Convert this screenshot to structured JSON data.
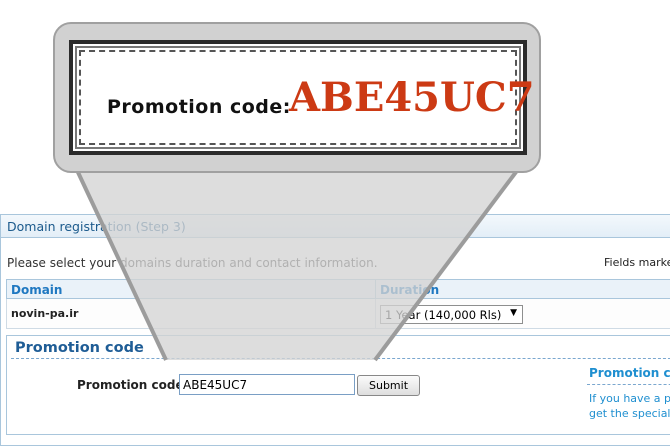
{
  "panel": {
    "title": "Domain registration (Step 3)",
    "instructions": "Please select your domains duration and contact information.",
    "fields_note": "Fields marked"
  },
  "table": {
    "headers": [
      "Domain",
      "Duration"
    ],
    "rows": [
      {
        "domain": "novin-pa.ir",
        "duration": "1 Year (140,000 Rls)"
      }
    ]
  },
  "promo": {
    "heading": "Promotion code",
    "label": "Promotion code",
    "value": "ABE45UC7",
    "submit_label": "Submit",
    "side_title": "Promotion co",
    "side_text_1": "If you have a pro",
    "side_text_2": "get the special pr"
  },
  "zoom": {
    "label": "Promotion code:",
    "code": "ABE45UC7"
  },
  "colors": {
    "accent_blue": "#1f78c1",
    "code_red": "#cc3a14"
  }
}
